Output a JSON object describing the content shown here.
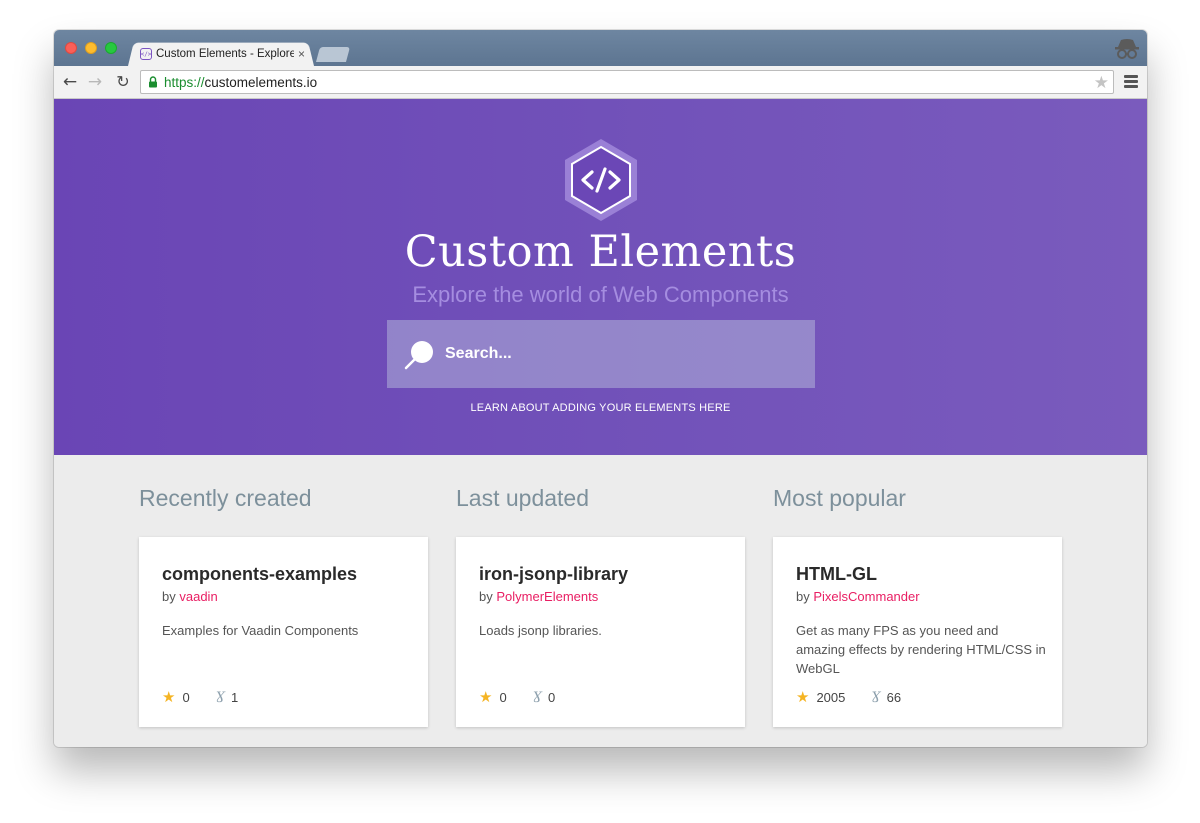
{
  "browser": {
    "tab_title": "Custom Elements - Explore",
    "tab_close": "×",
    "url_scheme": "https://",
    "url_host": "customelements.io"
  },
  "hero": {
    "title": "Custom Elements",
    "subtitle": "Explore the world of Web Components",
    "search_placeholder": "Search...",
    "link_text": "LEARN ABOUT ADDING YOUR ELEMENTS HERE"
  },
  "sections": [
    {
      "heading": "Recently created",
      "card": {
        "name": "components-examples",
        "by_label": "by",
        "author": "vaadin",
        "description": "Examples for Vaadin Components",
        "stars": "0",
        "forks": "1"
      }
    },
    {
      "heading": "Last updated",
      "card": {
        "name": "iron-jsonp-library",
        "by_label": "by",
        "author": "PolymerElements",
        "description": "Loads jsonp libraries.",
        "stars": "0",
        "forks": "0"
      }
    },
    {
      "heading": "Most popular",
      "card": {
        "name": "HTML-GL",
        "by_label": "by",
        "author": "PixelsCommander",
        "description": "Get as many FPS as you need and amazing effects by rendering HTML/CSS in WebGL",
        "stars": "2005",
        "forks": "66"
      }
    }
  ],
  "colors": {
    "hero_purple": "#6a45b5",
    "author_pink": "#e91e63",
    "star_yellow": "#f5b423",
    "heading_gray": "#7d909b"
  },
  "icons": {
    "logo": "code-brackets-hexagon-icon",
    "search": "search-icon",
    "star": "star-icon",
    "fork": "fork-icon"
  }
}
